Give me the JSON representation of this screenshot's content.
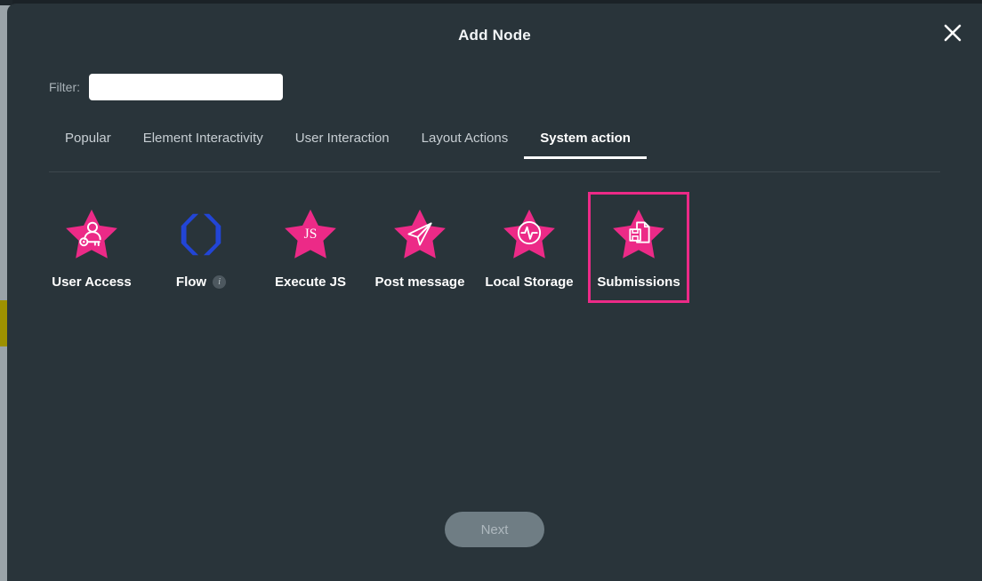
{
  "modal": {
    "title": "Add Node",
    "close_icon": "close-icon",
    "accent_color": "#ec2a87",
    "background_color": "#29343a"
  },
  "filter": {
    "label": "Filter:",
    "value": "",
    "placeholder": ""
  },
  "tabs": [
    {
      "label": "Popular",
      "active": false
    },
    {
      "label": "Element Interactivity",
      "active": false
    },
    {
      "label": "User Interaction",
      "active": false
    },
    {
      "label": "Layout Actions",
      "active": false
    },
    {
      "label": "System action",
      "active": true
    }
  ],
  "nodes": [
    {
      "label": "User Access",
      "icon": "user-key-star-icon",
      "selected": false,
      "info": false
    },
    {
      "label": "Flow",
      "icon": "flow-brackets-icon",
      "selected": false,
      "info": true,
      "info_badge": "i"
    },
    {
      "label": "Execute JS",
      "icon": "js-star-icon",
      "selected": false,
      "info": false,
      "glyph_text": "JS"
    },
    {
      "label": "Post message",
      "icon": "paper-plane-star-icon",
      "selected": false,
      "info": false
    },
    {
      "label": "Local Storage",
      "icon": "pulse-circle-star-icon",
      "selected": false,
      "info": false
    },
    {
      "label": "Submissions",
      "icon": "document-save-star-icon",
      "selected": true,
      "info": false
    }
  ],
  "footer": {
    "next_label": "Next",
    "next_disabled": true
  }
}
